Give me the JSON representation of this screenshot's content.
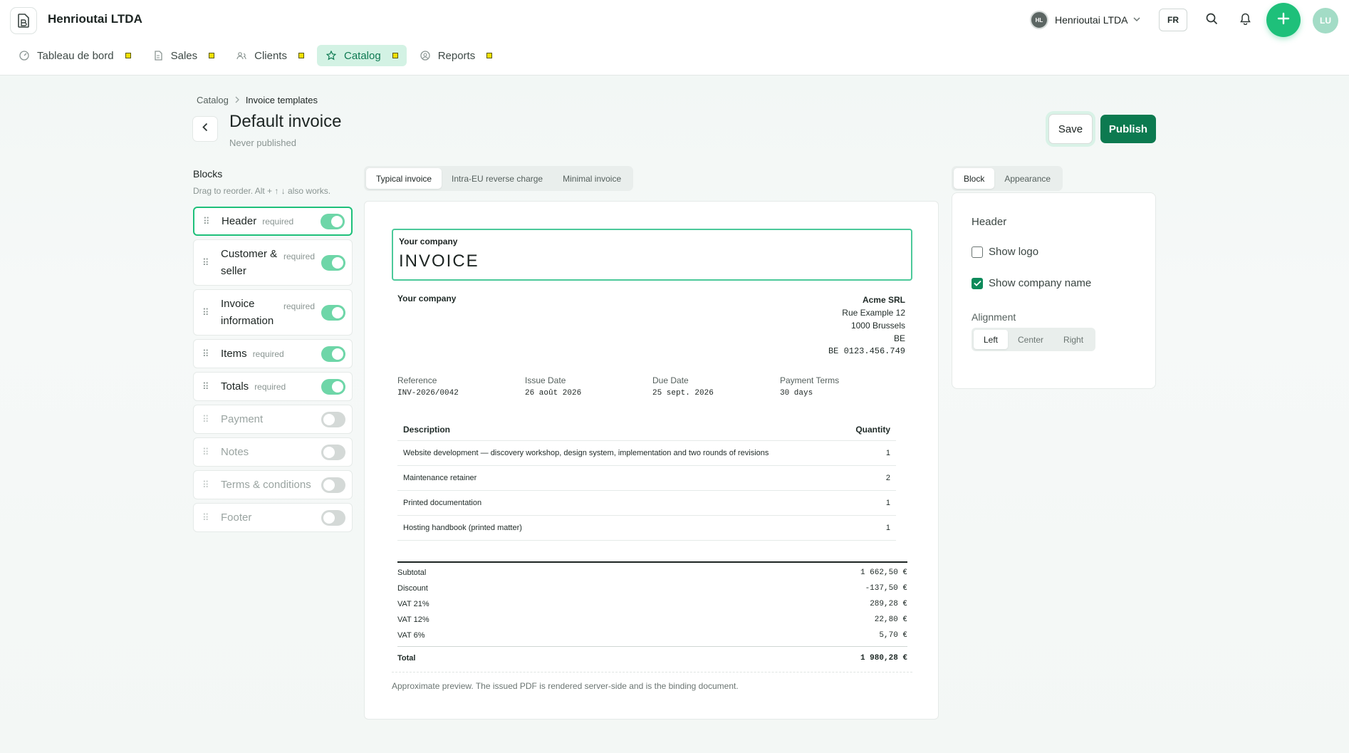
{
  "app": {
    "org_name": "Henrioutai LTDA",
    "nav": [
      {
        "label": "Tableau de bord",
        "icon": "dashboard-icon"
      },
      {
        "label": "Sales",
        "icon": "document-icon"
      },
      {
        "label": "Clients",
        "icon": "users-icon"
      },
      {
        "label": "Catalog",
        "icon": "star-icon",
        "active": true
      },
      {
        "label": "Reports",
        "icon": "reports-icon"
      }
    ],
    "org_switch": {
      "avatar": "HL",
      "name": "Henrioutai LTDA"
    },
    "language": "FR",
    "user_initials": "LU"
  },
  "page": {
    "breadcrumb": [
      "Catalog",
      "Invoice templates"
    ],
    "title": "Default invoice",
    "subtitle": "Never published",
    "save_label": "Save",
    "publish_label": "Publish"
  },
  "blocks": {
    "title": "Blocks",
    "hint": "Drag to reorder. Alt + ↑ ↓ also works.",
    "required_label": "required",
    "items": [
      {
        "label": "Header",
        "required": true,
        "enabled": true
      },
      {
        "label": "Customer & seller",
        "required": true,
        "enabled": true
      },
      {
        "label": "Invoice information",
        "required": true,
        "enabled": true
      },
      {
        "label": "Items",
        "required": true,
        "enabled": true
      },
      {
        "label": "Totals",
        "required": true,
        "enabled": true
      },
      {
        "label": "Payment",
        "required": false,
        "enabled": false
      },
      {
        "label": "Notes",
        "required": false,
        "enabled": false
      },
      {
        "label": "Terms & conditions",
        "required": false,
        "enabled": false
      },
      {
        "label": "Footer",
        "required": false,
        "enabled": false
      }
    ]
  },
  "preview_tabs": [
    "Typical invoice",
    "Intra-EU reverse charge",
    "Minimal invoice"
  ],
  "invoice": {
    "header_company": "Your company",
    "header_title": "INVOICE",
    "seller_name": "Your company",
    "buyer": {
      "name": "Acme SRL",
      "street": "Rue Example 12",
      "city": "1000 Brussels",
      "country": "BE",
      "vat": "BE 0123.456.749"
    },
    "meta": [
      {
        "label": "Reference",
        "value": "INV-2026/0042"
      },
      {
        "label": "Issue Date",
        "value": "26 août 2026"
      },
      {
        "label": "Due Date",
        "value": "25 sept. 2026"
      },
      {
        "label": "Payment Terms",
        "value": "30 days"
      }
    ],
    "items_header": {
      "description": "Description",
      "quantity": "Quantity"
    },
    "items": [
      {
        "description": "Website development — discovery workshop, design system, implementation and two rounds of revisions",
        "quantity": "1"
      },
      {
        "description": "Maintenance retainer",
        "quantity": "2"
      },
      {
        "description": "Printed documentation",
        "quantity": "1"
      },
      {
        "description": "Hosting handbook (printed matter)",
        "quantity": "1"
      }
    ],
    "totals": [
      {
        "label": "Subtotal",
        "value": "1 662,50 €"
      },
      {
        "label": "Discount",
        "value": "-137,50 €"
      },
      {
        "label": "VAT 21%",
        "value": "289,28 €"
      },
      {
        "label": "VAT 12%",
        "value": "22,80 €"
      },
      {
        "label": "VAT 6%",
        "value": "5,70 €"
      }
    ],
    "total": {
      "label": "Total",
      "value": "1 980,28 €"
    },
    "disclaimer": "Approximate preview. The issued PDF is rendered server-side and is the binding document."
  },
  "properties": {
    "tabs": [
      "Block",
      "Appearance"
    ],
    "section": "Header",
    "show_logo": {
      "label": "Show logo",
      "checked": false
    },
    "show_company_name": {
      "label": "Show company name",
      "checked": true
    },
    "alignment_label": "Alignment",
    "alignment_options": [
      "Left",
      "Center",
      "Right"
    ],
    "alignment_selected": "Left"
  },
  "colors": {
    "accent": "#1ec07a",
    "primary_dark": "#0c7a50",
    "nav_active_bg": "#d3f2e4",
    "toggle_on": "#6ed6a8"
  }
}
